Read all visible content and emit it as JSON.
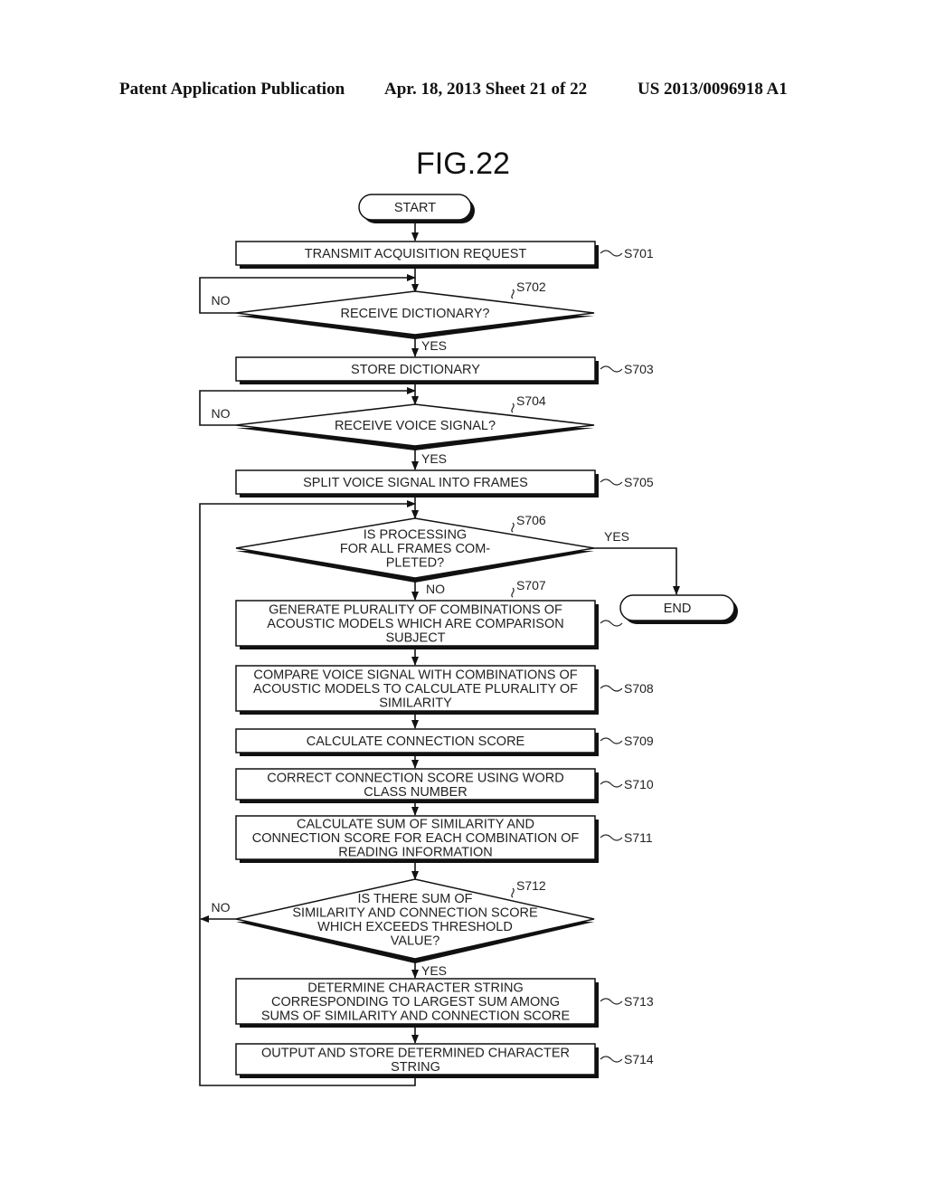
{
  "header": {
    "publication": "Patent Application Publication",
    "date_sheet": "Apr. 18, 2013  Sheet 21 of 22",
    "patent_number": "US 2013/0096918 A1"
  },
  "figure": {
    "title": "FIG.22",
    "terminals": {
      "start": "START",
      "end": "END"
    },
    "branch_labels": {
      "yes": "YES",
      "no": "NO"
    },
    "steps": [
      {
        "id": "S701",
        "type": "process",
        "lines": [
          "TRANSMIT ACQUISITION REQUEST"
        ]
      },
      {
        "id": "S702",
        "type": "decision",
        "lines": [
          "RECEIVE DICTIONARY?"
        ]
      },
      {
        "id": "S703",
        "type": "process",
        "lines": [
          "STORE DICTIONARY"
        ]
      },
      {
        "id": "S704",
        "type": "decision",
        "lines": [
          "RECEIVE VOICE SIGNAL?"
        ]
      },
      {
        "id": "S705",
        "type": "process",
        "lines": [
          "SPLIT VOICE SIGNAL INTO FRAMES"
        ]
      },
      {
        "id": "S706",
        "type": "decision",
        "lines": [
          "IS PROCESSING",
          "FOR ALL FRAMES COM-",
          "PLETED?"
        ]
      },
      {
        "id": "S707",
        "type": "process",
        "lines": [
          "GENERATE PLURALITY OF COMBINATIONS OF",
          "ACOUSTIC MODELS WHICH ARE COMPARISON",
          "SUBJECT"
        ]
      },
      {
        "id": "S708",
        "type": "process",
        "lines": [
          "COMPARE VOICE SIGNAL WITH COMBINATIONS OF",
          "ACOUSTIC MODELS TO CALCULATE PLURALITY OF",
          "SIMILARITY"
        ]
      },
      {
        "id": "S709",
        "type": "process",
        "lines": [
          "CALCULATE CONNECTION SCORE"
        ]
      },
      {
        "id": "S710",
        "type": "process",
        "lines": [
          "CORRECT CONNECTION SCORE USING WORD",
          "CLASS NUMBER"
        ]
      },
      {
        "id": "S711",
        "type": "process",
        "lines": [
          "CALCULATE SUM OF SIMILARITY AND",
          "CONNECTION SCORE FOR EACH COMBINATION OF",
          "READING INFORMATION"
        ]
      },
      {
        "id": "S712",
        "type": "decision",
        "lines": [
          "IS THERE SUM OF",
          "SIMILARITY AND CONNECTION SCORE",
          "WHICH EXCEEDS THRESHOLD",
          "VALUE?"
        ]
      },
      {
        "id": "S713",
        "type": "process",
        "lines": [
          "DETERMINE CHARACTER STRING",
          "CORRESPONDING TO LARGEST SUM AMONG",
          "SUMS OF SIMILARITY AND CONNECTION SCORE"
        ]
      },
      {
        "id": "S714",
        "type": "process",
        "lines": [
          "OUTPUT AND STORE DETERMINED CHARACTER",
          "STRING"
        ]
      }
    ]
  }
}
